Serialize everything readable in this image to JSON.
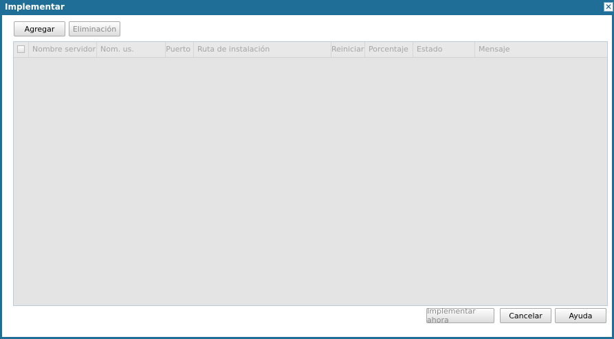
{
  "window": {
    "title": "Implementar",
    "close_glyph": "✕"
  },
  "toolbar": {
    "add_label": "Agregar",
    "remove_label": "Eliminación"
  },
  "table": {
    "columns": [
      {
        "label": ""
      },
      {
        "label": "Nombre servidor"
      },
      {
        "label": "Nom. us."
      },
      {
        "label": "Puerto"
      },
      {
        "label": "Ruta de instalación"
      },
      {
        "label": "Reiniciar"
      },
      {
        "label": "Porcentaje"
      },
      {
        "label": "Estado"
      },
      {
        "label": "Mensaje"
      }
    ],
    "rows": []
  },
  "footer": {
    "deploy_now_label": "Implementar ahora",
    "cancel_label": "Cancelar",
    "help_label": "Ayuda"
  }
}
